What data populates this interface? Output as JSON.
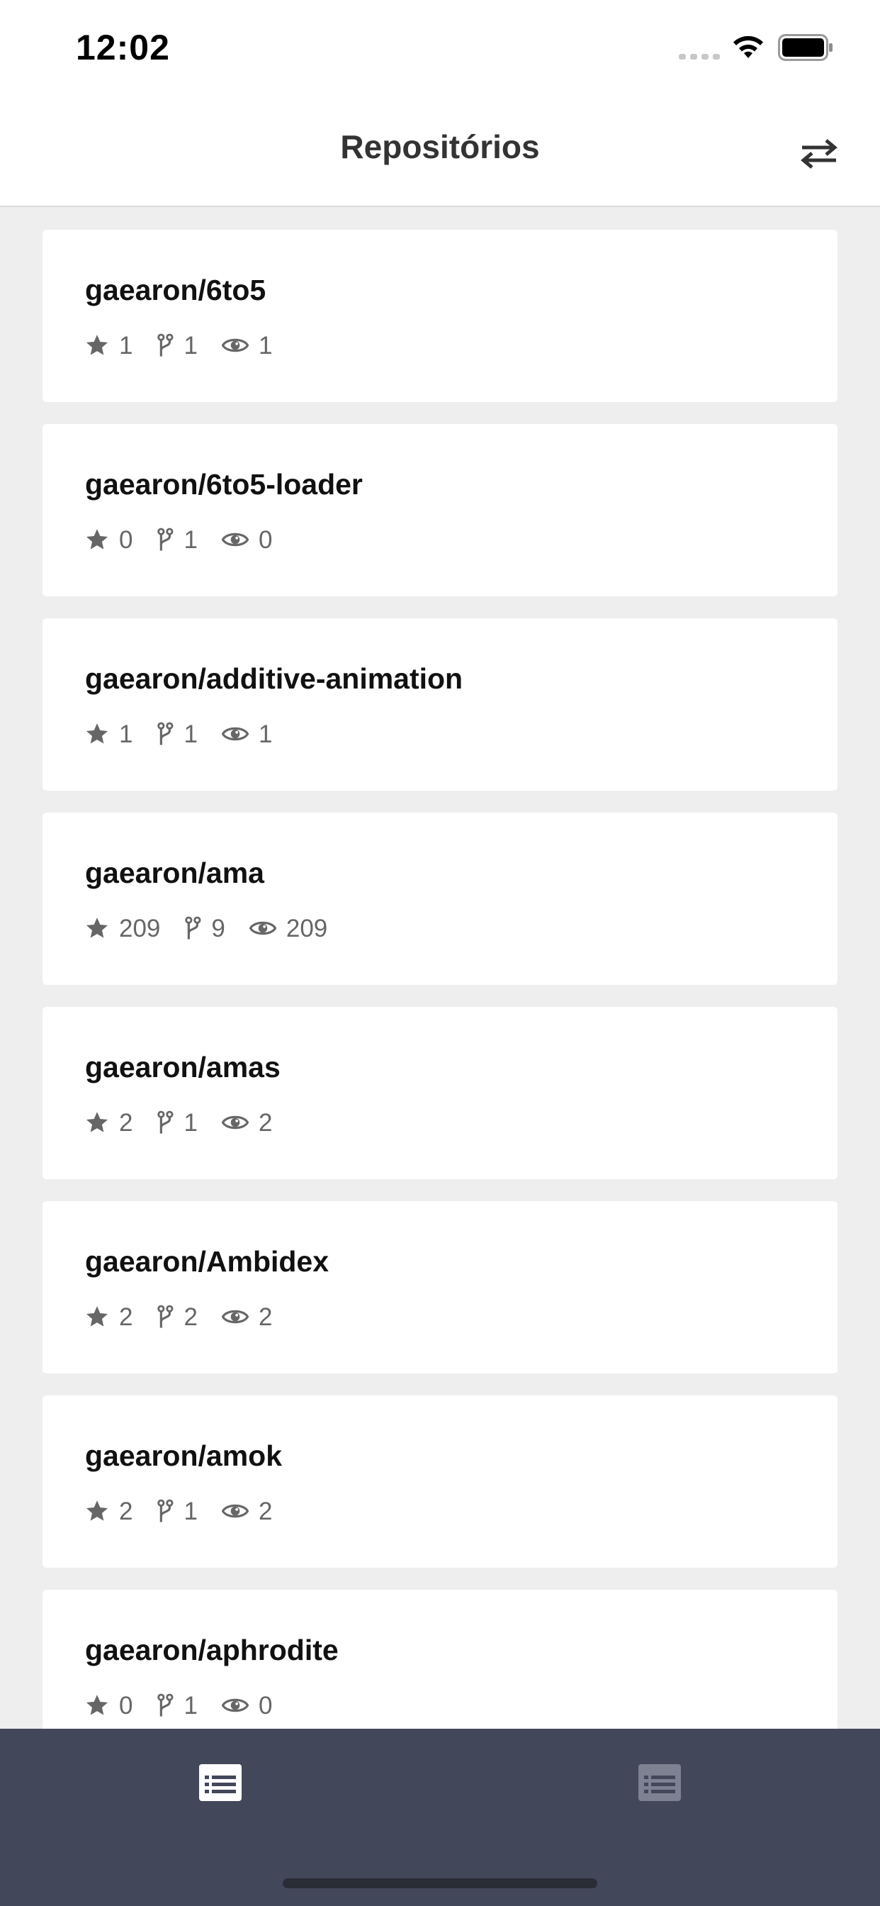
{
  "status_bar": {
    "time": "12:02"
  },
  "header": {
    "title": "Repositórios",
    "action_icon": "swap-arrows-icon"
  },
  "repos": [
    {
      "name": "gaearon/6to5",
      "stars": "1",
      "forks": "1",
      "watchers": "1"
    },
    {
      "name": "gaearon/6to5-loader",
      "stars": "0",
      "forks": "1",
      "watchers": "0"
    },
    {
      "name": "gaearon/additive-animation",
      "stars": "1",
      "forks": "1",
      "watchers": "1"
    },
    {
      "name": "gaearon/ama",
      "stars": "209",
      "forks": "9",
      "watchers": "209"
    },
    {
      "name": "gaearon/amas",
      "stars": "2",
      "forks": "1",
      "watchers": "2"
    },
    {
      "name": "gaearon/Ambidex",
      "stars": "2",
      "forks": "2",
      "watchers": "2"
    },
    {
      "name": "gaearon/amok",
      "stars": "2",
      "forks": "1",
      "watchers": "2"
    },
    {
      "name": "gaearon/aphrodite",
      "stars": "0",
      "forks": "1",
      "watchers": "0"
    }
  ],
  "tab_bar": {
    "tabs": [
      {
        "icon": "list-icon",
        "active": true
      },
      {
        "icon": "list-icon",
        "active": false
      }
    ]
  },
  "colors": {
    "background": "#eeeeee",
    "card": "#ffffff",
    "tab_bar": "#43475a",
    "tab_active": "#ffffff",
    "tab_inactive": "#7d8191",
    "stat_text": "#666666"
  }
}
